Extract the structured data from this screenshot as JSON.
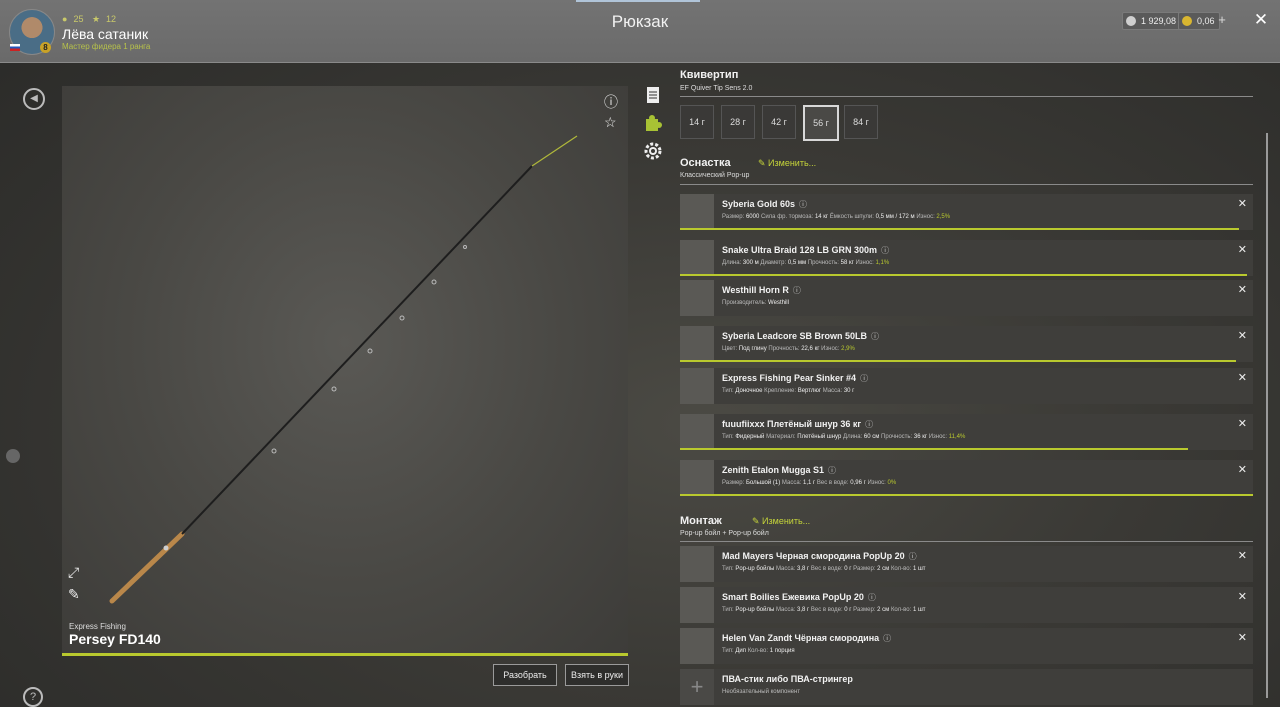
{
  "page_title": "Рюкзак",
  "player": {
    "name": "Лёва сатаник",
    "subtitle": "Мастер фидера 1 ранга",
    "stat1": "25",
    "stat2": "12",
    "level": "8"
  },
  "currency": {
    "silver": "1 929,08",
    "gold": "0,06"
  },
  "rod": {
    "brand": "Express Fishing",
    "name": "Persey FD140",
    "condition": 1.0
  },
  "buttons": {
    "disassemble": "Разобрать",
    "take": "Взять в руки"
  },
  "quivertip": {
    "title": "Квивертип",
    "subtitle": "EF Quiver Tip Sens 2.0",
    "weights": [
      "14 г",
      "28 г",
      "42 г",
      "56 г",
      "84 г"
    ],
    "selected": "56 г"
  },
  "rig": {
    "title": "Оснастка",
    "edit": "Изменить...",
    "subtitle": "Классический Pop-up"
  },
  "rig_items": [
    {
      "name": "Syberia Gold 60s",
      "details": [
        [
          "Размер:",
          "6000"
        ],
        [
          "Сила фр. тормоза:",
          "14 кг"
        ],
        [
          "Ёмкость шпули:",
          "0,5 мм / 172 м"
        ],
        [
          "Износ:",
          "2,5%"
        ]
      ],
      "condition": 0.975
    },
    {
      "name": "Snake Ultra Braid 128 LB GRN 300m",
      "details": [
        [
          "Длина:",
          "300 м"
        ],
        [
          "Диаметр:",
          "0,5 мм"
        ],
        [
          "Прочность:",
          "58 кг"
        ],
        [
          "Износ:",
          "1,1%"
        ]
      ],
      "condition": 0.989
    },
    {
      "name": "Westhill Horn R",
      "details": [
        [
          "Производитель:",
          "Westhill"
        ]
      ],
      "condition": null
    },
    {
      "name": "Syberia Leadcore SB Brown 50LB",
      "details": [
        [
          "Цвет:",
          "Под глину"
        ],
        [
          "Прочность:",
          "22,6 кг"
        ],
        [
          "Износ:",
          "2,9%"
        ]
      ],
      "condition": 0.971
    },
    {
      "name": "Express Fishing Pear Sinker #4",
      "details": [
        [
          "Тип:",
          "Доночное"
        ],
        [
          "Крепление:",
          "Вертлюг"
        ],
        [
          "Масса:",
          "30 г"
        ]
      ],
      "condition": null
    },
    {
      "name": "fuuufiixxx Плетёный шнур 36 кг",
      "details": [
        [
          "Тип:",
          "Фидерный"
        ],
        [
          "Материал:",
          "Плетёный шнур"
        ],
        [
          "Длина:",
          "60 см"
        ],
        [
          "Прочность:",
          "36 кг"
        ],
        [
          "Износ:",
          "11,4%"
        ]
      ],
      "condition": 0.886
    },
    {
      "name": "Zenith Etalon Mugga S1",
      "details": [
        [
          "Размер:",
          "Большой (1)"
        ],
        [
          "Масса:",
          "1,1 г"
        ],
        [
          "Вес в воде:",
          "0,96 г"
        ],
        [
          "Износ:",
          "0%"
        ]
      ],
      "condition": 1.0
    }
  ],
  "montage": {
    "title": "Монтаж",
    "edit": "Изменить...",
    "subtitle": "Pop-up бойл + Pop-up бойл"
  },
  "montage_items": [
    {
      "name": "Mad Mayers Черная смородина PopUp 20",
      "details": [
        [
          "Тип:",
          "Pop-up бойлы"
        ],
        [
          "Масса:",
          "3,8 г"
        ],
        [
          "Вес в воде:",
          "0 г"
        ],
        [
          "Размер:",
          "2 см"
        ],
        [
          "Кол-во:",
          "1 шт"
        ]
      ]
    },
    {
      "name": "Smart Boilies Ежевика PopUp 20",
      "details": [
        [
          "Тип:",
          "Pop-up бойлы"
        ],
        [
          "Масса:",
          "3,8 г"
        ],
        [
          "Вес в воде:",
          "0 г"
        ],
        [
          "Размер:",
          "2 см"
        ],
        [
          "Кол-во:",
          "1 шт"
        ]
      ]
    },
    {
      "name": "Helen Van Zandt Чёрная смородина",
      "details": [
        [
          "Тип:",
          "Дип"
        ],
        [
          "Кол-во:",
          "1 порция"
        ]
      ]
    },
    {
      "name": "ПВА-стик либо ПВА-стрингер",
      "details": [
        [
          "Необязательный компонент",
          ""
        ]
      ]
    }
  ],
  "icons": {
    "info": "info-icon",
    "star": "star-icon",
    "expand": "expand-icon",
    "paint": "brush-icon"
  }
}
